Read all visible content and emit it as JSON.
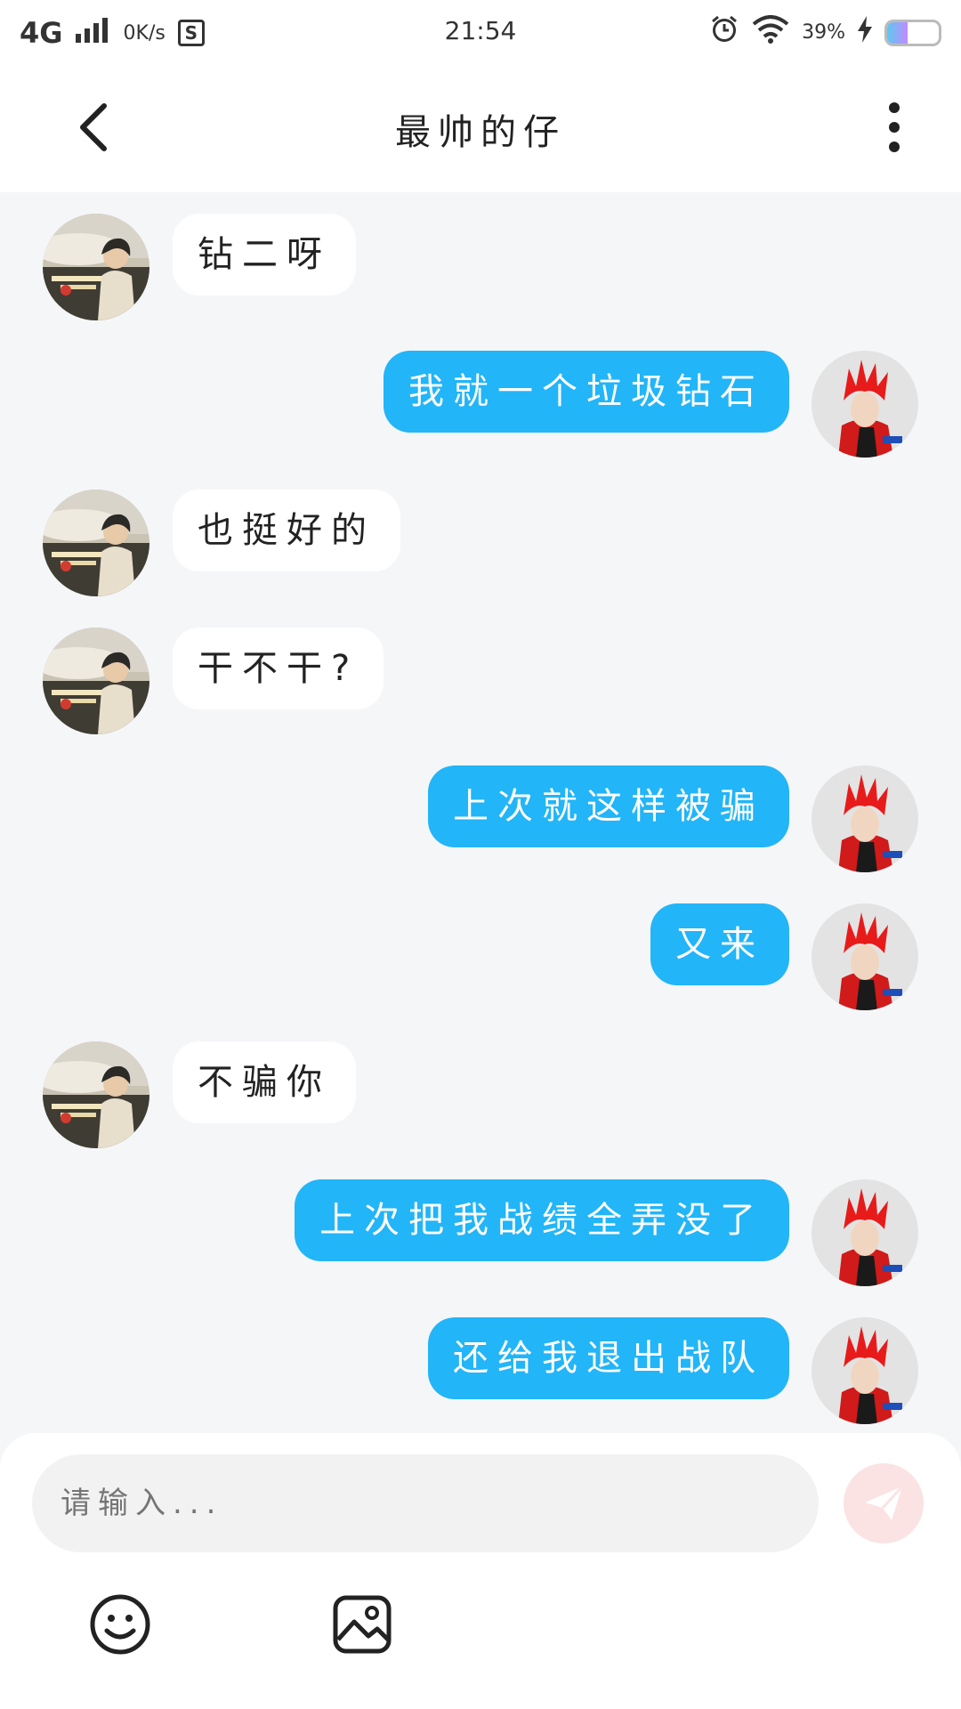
{
  "statusbar": {
    "network": "4G",
    "speed": "0K/s",
    "s_badge": "S",
    "time": "21:54",
    "battery_text": "39%",
    "battery_level": 0.39
  },
  "header": {
    "title": "最帅的仔"
  },
  "messages": [
    {
      "side": "other",
      "text": "钻二呀"
    },
    {
      "side": "me",
      "text": "我就一个垃圾钻石"
    },
    {
      "side": "other",
      "text": "也挺好的"
    },
    {
      "side": "other",
      "text": "干不干?"
    },
    {
      "side": "me",
      "text": "上次就这样被骗"
    },
    {
      "side": "me",
      "text": "又来"
    },
    {
      "side": "other",
      "text": "不骗你"
    },
    {
      "side": "me",
      "text": "上次把我战绩全弄没了"
    },
    {
      "side": "me",
      "text": "还给我退出战队"
    }
  ],
  "input": {
    "placeholder": "请输入..."
  },
  "colors": {
    "my_bubble": "#22b5f8",
    "other_bubble": "#ffffff",
    "send_button_bg": "#fbe3e3"
  }
}
